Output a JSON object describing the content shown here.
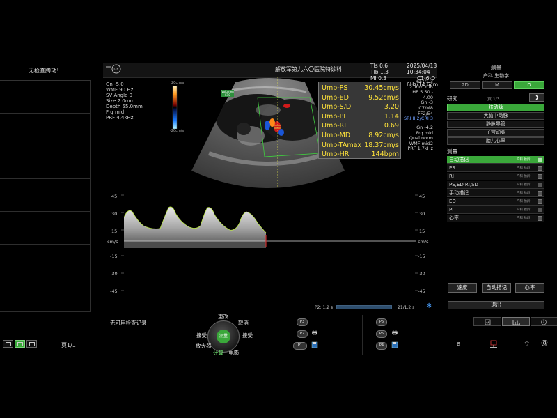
{
  "left_panel": {
    "status_text": "无检查腾动！",
    "page_label": "页1/1",
    "view_buttons": [
      "single-view",
      "dual-view",
      "grid-view"
    ]
  },
  "header": {
    "hospital": "解放军第九六〇医院特诊科",
    "tis": "TIs  0.6",
    "tib": "TIb  1.3",
    "mi": "MI   0.3",
    "date": "2025/04/13",
    "time": "10:34:04",
    "probe": "C1-6-D",
    "freq_depth": "6Hz/14.6cm"
  },
  "left_params": [
    "Gn -5.0",
    "WMF 90 Hz",
    "SV Angle  0",
    "Size  2.0mm",
    "Depth 55.0mm",
    "Frq mid",
    "PRF  4.4kHz"
  ],
  "color_bar": {
    "top": "20cm/s",
    "bottom": "-20cm/s"
  },
  "right_params": [
    "65°/1.3",
    "2 Trim./OB",
    "HP 5.50 - 4.00",
    "Gn  -3",
    "C7/M8",
    "FF2/E4"
  ],
  "right_params_sri": "SRI II 2/CRI 3",
  "right_params2": [
    "Gn -4.2",
    "Frq mid",
    "Qual norm",
    "WMF mid2",
    "PRF  1.7kHz"
  ],
  "probe_badge": "Volumen E10",
  "measurements": [
    {
      "label": "Umb-PS",
      "value": "30.45cm/s"
    },
    {
      "label": "Umb-ED",
      "value": "9.52cm/s"
    },
    {
      "label": "Umb-S/D",
      "value": "3.20"
    },
    {
      "label": "Umb-PI",
      "value": "1.14"
    },
    {
      "label": "Umb-RI",
      "value": "0.69"
    },
    {
      "label": "Umb-MD",
      "value": "8.92cm/s"
    },
    {
      "label": "Umb-TAmax",
      "value": "18.37cm/s"
    },
    {
      "label": "Umb-HR",
      "value": "144bpm"
    }
  ],
  "doppler": {
    "ticks": [
      "45",
      "30",
      "15",
      "cm/s",
      "-15",
      "-30",
      "-45"
    ]
  },
  "right_menu": {
    "title": "测量",
    "subtitle": "产科 生物学",
    "mode_tabs": [
      "2D",
      "M",
      "D"
    ],
    "active_mode": "D",
    "study_label": "研究",
    "study_page": "页 1/3",
    "study_next": "❯",
    "study_items": [
      "脐动脉",
      "大脑中动脉",
      "静脉导管",
      "子宫动脉",
      "胎儿心率"
    ],
    "meas_label": "测量",
    "meas_items": [
      {
        "label": "自动描记",
        "src": "产科 胎龄"
      },
      {
        "label": "PS",
        "src": "产科 胎龄"
      },
      {
        "label": "RI",
        "src": "产科 胎龄"
      },
      {
        "label": "PS,ED RI,SD",
        "src": "产科 胎龄"
      },
      {
        "label": "手动描记",
        "src": "产科 胎龄"
      },
      {
        "label": "ED",
        "src": "产科 胎龄"
      },
      {
        "label": "PI",
        "src": "产科 胎龄"
      },
      {
        "label": "心率",
        "src": "产科 胎龄"
      }
    ],
    "action_buttons": [
      "速度",
      "自动描记",
      "心率"
    ],
    "exit_label": "退出"
  },
  "cine": {
    "left": "P2:  1.2 s",
    "right": "21/1.2 s"
  },
  "bottom": {
    "no_record": "无可用检查记录",
    "trackball_center": "测量",
    "change": "更改",
    "cancel": "取消",
    "accept_left": "接受",
    "accept_right": "接受",
    "zoom": "放大器",
    "compute": "计算",
    "separator": "|",
    "cine_mode": "电影",
    "p_buttons": [
      "P3",
      "P2",
      "P1",
      "P6",
      "P5",
      "P4"
    ]
  },
  "status": {
    "a": "a",
    "at": "@"
  },
  "colors": {
    "accent": "#3aa83a",
    "measurement": "#ffe33a"
  }
}
